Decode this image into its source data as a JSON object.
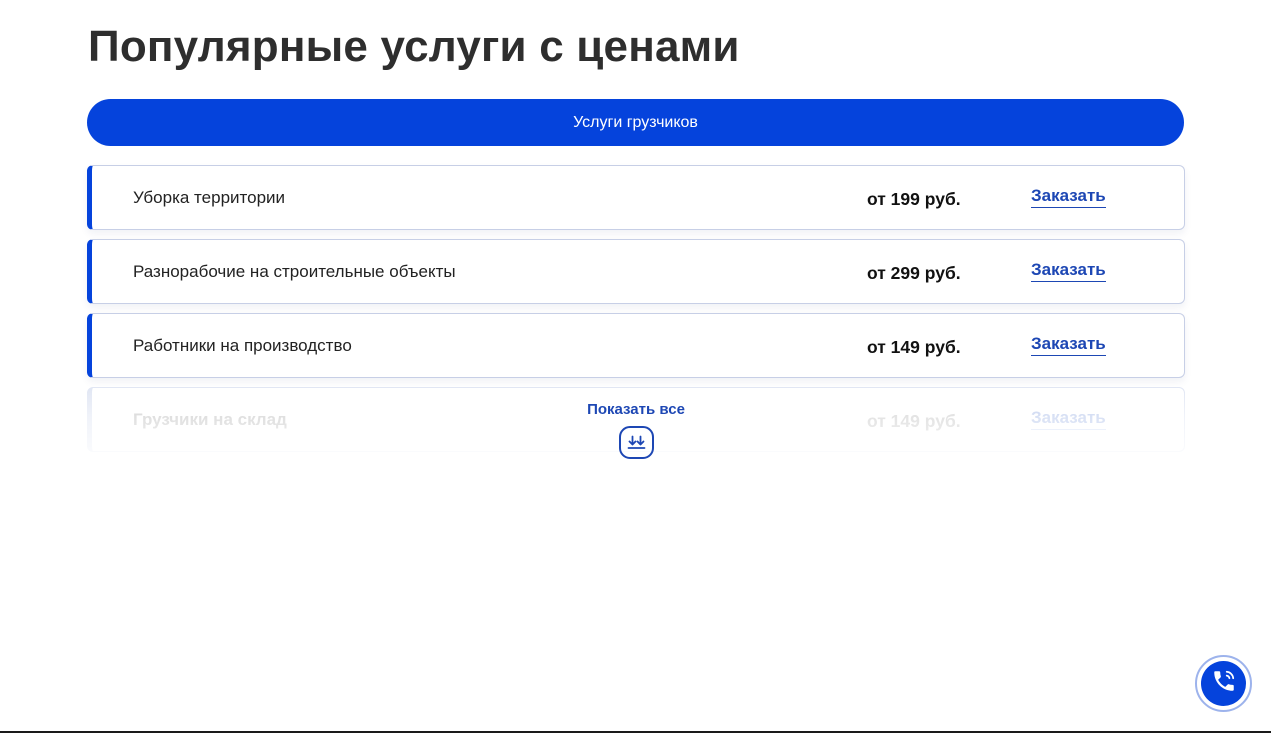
{
  "page_title": "Популярные услуги с ценами",
  "tab": {
    "label": "Услуги грузчиков"
  },
  "services": [
    {
      "name": "Уборка территории",
      "price": "от 199 руб.",
      "order_label": "Заказать"
    },
    {
      "name": "Разнорабочие на строительные объекты",
      "price": "от 299 руб.",
      "order_label": "Заказать"
    },
    {
      "name": "Работники на производство",
      "price": "от 149 руб.",
      "order_label": "Заказать"
    },
    {
      "name": "Грузчики на склад",
      "price": "от 149 руб.",
      "order_label": "Заказать"
    }
  ],
  "show_all": {
    "label": "Показать все",
    "icon": "double-arrow-down-icon"
  },
  "call_button": {
    "icon": "phone-call-icon"
  },
  "colors": {
    "accent": "#0543dc",
    "link": "#1d47b4",
    "title": "#2e2e2e"
  }
}
